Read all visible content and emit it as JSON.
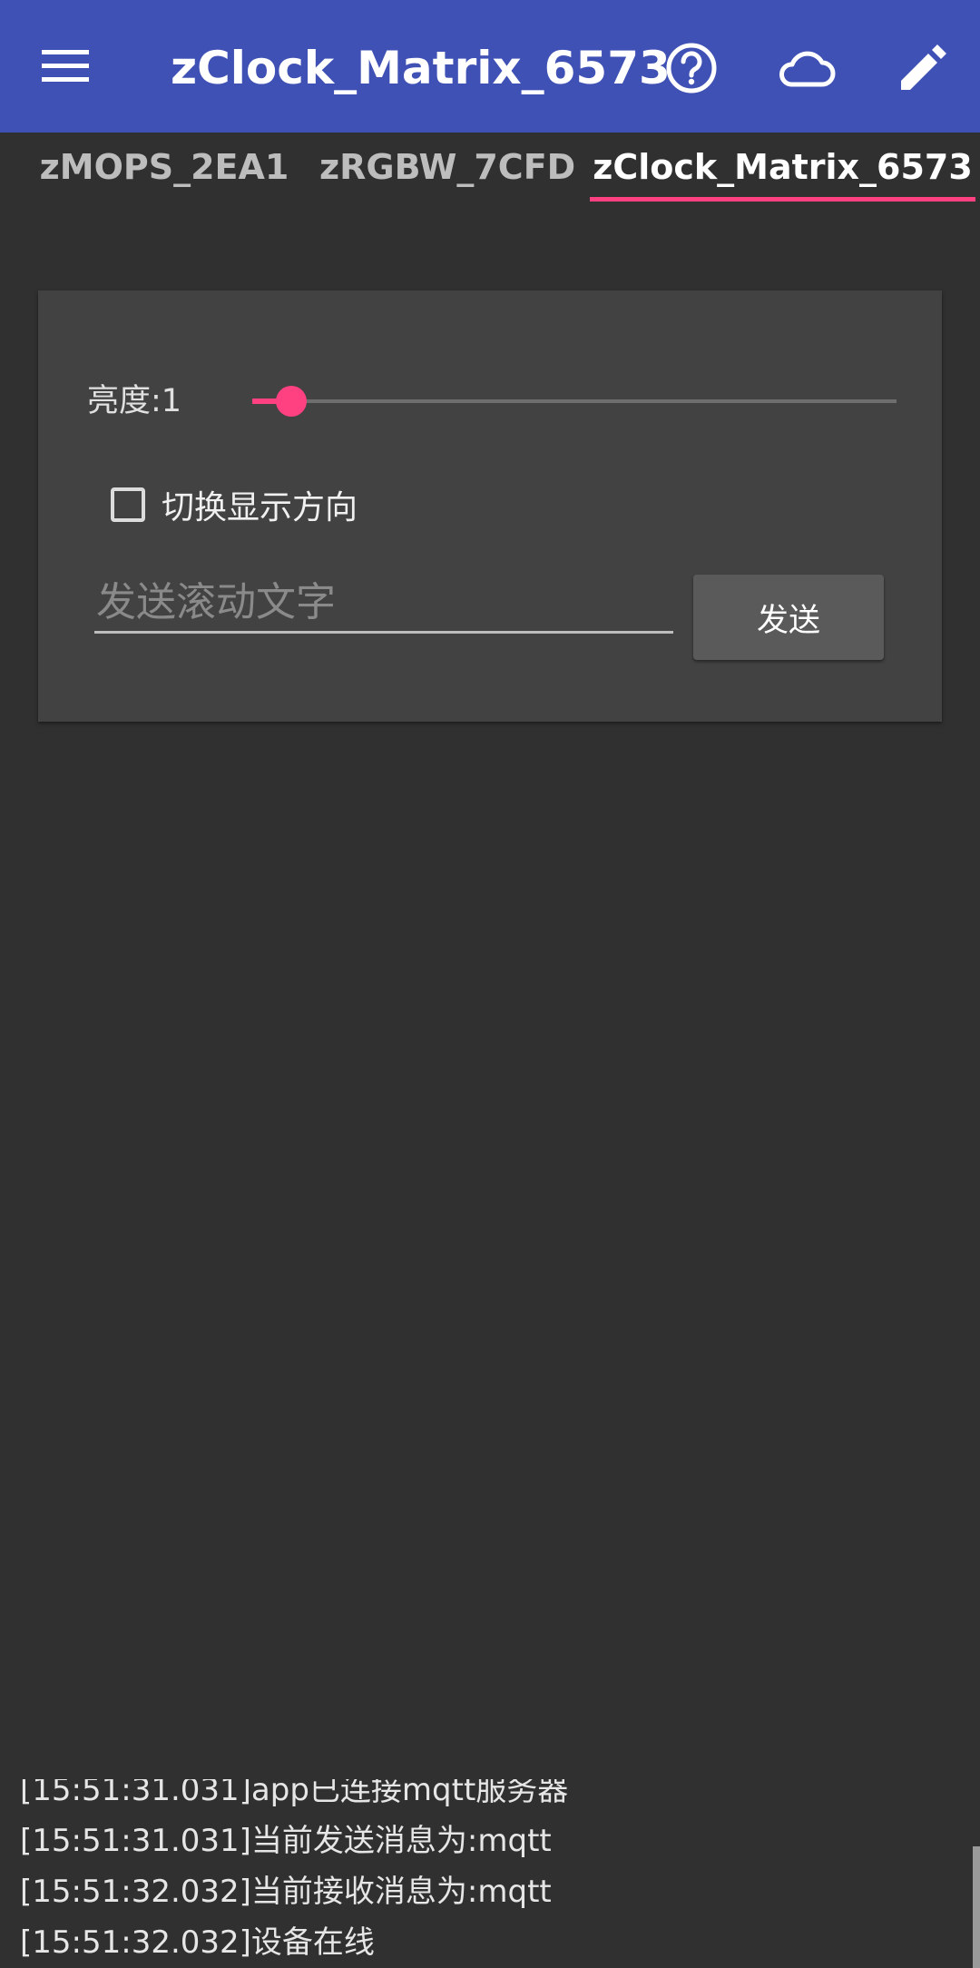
{
  "appbar": {
    "title": "zClock_Matrix_6573",
    "icons": [
      "menu-icon",
      "help-icon",
      "cloud-icon",
      "edit-icon"
    ]
  },
  "tabs": [
    {
      "label": "zMOPS_2EA1",
      "selected": false
    },
    {
      "label": "zRGBW_7CFD",
      "selected": false
    },
    {
      "label": "zClock_Matrix_6573",
      "selected": true
    }
  ],
  "controls": {
    "brightness_label": "亮度:1",
    "brightness_fraction": 0.06,
    "checkbox_label": "切换显示方向",
    "checkbox_checked": false,
    "input_placeholder": "发送滚动文字",
    "input_value": "",
    "send_label": "发送"
  },
  "log": [
    "[15:51:31.031]app已连接mqtt服务器",
    "[15:51:31.031]当前发送消息为:mqtt",
    "[15:51:32.032]当前接收消息为:mqtt",
    "[15:51:32.032]设备在线"
  ],
  "colors": {
    "appbar": "#3f51b5",
    "accent": "#ff4081",
    "background": "#303030",
    "card": "#424242"
  }
}
